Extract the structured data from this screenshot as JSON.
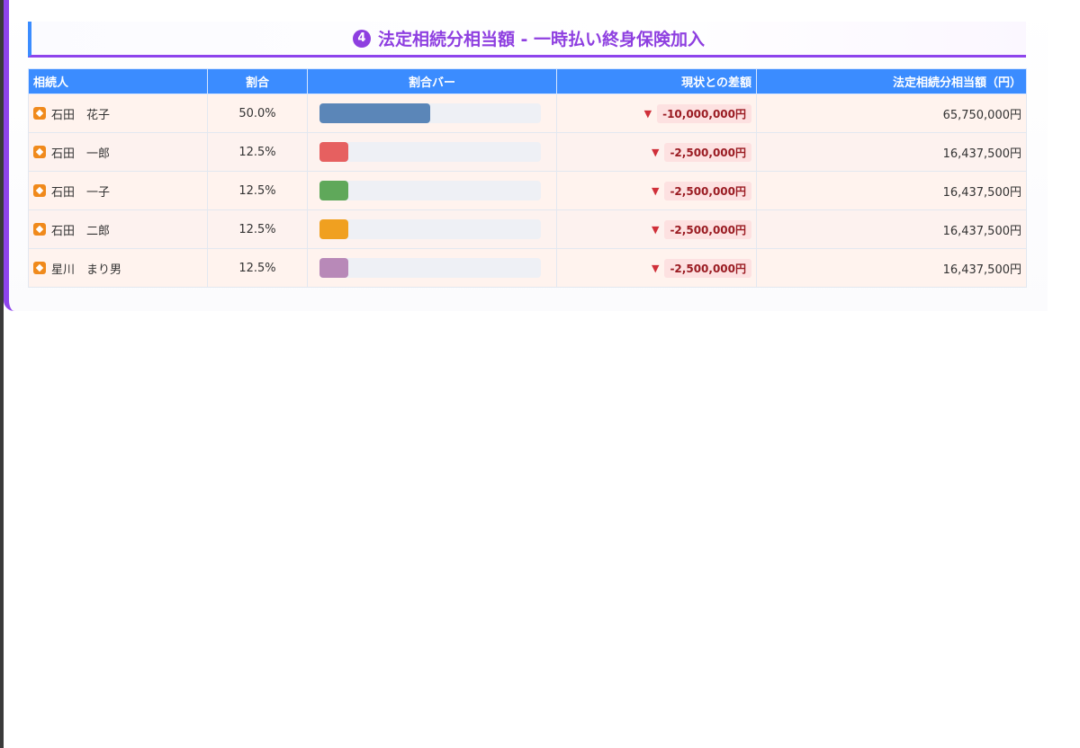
{
  "section": {
    "number_glyph": "4",
    "title": "法定相続分相当額 - 一時払い終身保険加入"
  },
  "table": {
    "headers": {
      "heir": "相続人",
      "ratio": "割合",
      "ratio_bar": "割合バー",
      "diff": "現状との差額",
      "amount": "法定相続分相当額（円）"
    },
    "rows": [
      {
        "name": "石田　花子",
        "ratio": "50.0%",
        "ratio_value": 0.5,
        "bar_color": "#5b86b8",
        "diff_arrow": "▼",
        "diff": "-10,000,000円",
        "amount": "65,750,000円"
      },
      {
        "name": "石田　一郎",
        "ratio": "12.5%",
        "ratio_value": 0.125,
        "bar_color": "#e66060",
        "diff_arrow": "▼",
        "diff": "-2,500,000円",
        "amount": "16,437,500円"
      },
      {
        "name": "石田　一子",
        "ratio": "12.5%",
        "ratio_value": 0.125,
        "bar_color": "#5fa85a",
        "diff_arrow": "▼",
        "diff": "-2,500,000円",
        "amount": "16,437,500円"
      },
      {
        "name": "石田　二郎",
        "ratio": "12.5%",
        "ratio_value": 0.125,
        "bar_color": "#f0a020",
        "diff_arrow": "▼",
        "diff": "-2,500,000円",
        "amount": "16,437,500円"
      },
      {
        "name": "星川　まり男",
        "ratio": "12.5%",
        "ratio_value": 0.125,
        "bar_color": "#b889b8",
        "diff_arrow": "▼",
        "diff": "-2,500,000円",
        "amount": "16,437,500円"
      }
    ]
  }
}
